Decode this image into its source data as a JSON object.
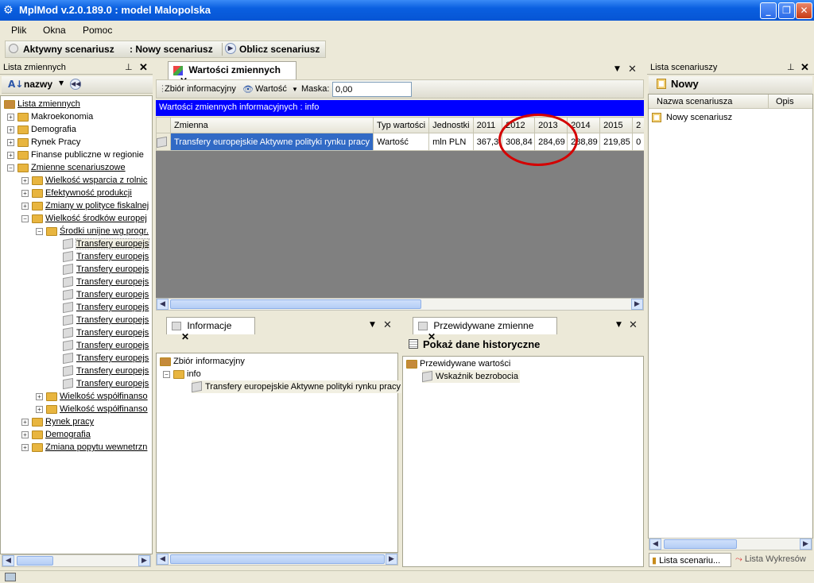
{
  "window": {
    "title": "MplMod v.2.0.189.0 : model Malopolska"
  },
  "menu": [
    "Plik",
    "Okna",
    "Pomoc"
  ],
  "scenario_bar": {
    "active_label": "Aktywny scenariusz",
    "active_value": ": Nowy scenariusz",
    "compute_label": "Oblicz scenariusz"
  },
  "left_panel": {
    "title": "Lista zmiennych",
    "sort_label": "nazwy",
    "tree": [
      {
        "label": "Lista zmiennych",
        "level": 0,
        "type": "root",
        "expander": ""
      },
      {
        "label": "Makroekonomia",
        "level": 1,
        "type": "folder",
        "expander": "+"
      },
      {
        "label": "Demografia",
        "level": 1,
        "type": "folder",
        "expander": "+"
      },
      {
        "label": "Rynek Pracy",
        "level": 1,
        "type": "folder",
        "expander": "+"
      },
      {
        "label": "Finanse publiczne w regionie",
        "level": 1,
        "type": "folder",
        "expander": "+"
      },
      {
        "label": "Zmienne scenariuszowe",
        "level": 1,
        "type": "folder",
        "expander": "-",
        "underline": true
      },
      {
        "label": "Wielkość wsparcia z rolnic",
        "level": 2,
        "type": "folder",
        "expander": "+",
        "underline": true
      },
      {
        "label": "Efektywność produkcji",
        "level": 2,
        "type": "folder",
        "expander": "+",
        "underline": true
      },
      {
        "label": "Zmiany w polityce fiskalnej",
        "level": 2,
        "type": "folder",
        "expander": "+",
        "underline": true
      },
      {
        "label": "Wielkość środków europej",
        "level": 2,
        "type": "folder",
        "expander": "-",
        "underline": true
      },
      {
        "label": "Środki unijne wg progr.",
        "level": 3,
        "type": "folder",
        "expander": "-",
        "underline": true
      },
      {
        "label": "Transfery europejs",
        "level": 4,
        "type": "cube",
        "expander": "",
        "underline": true,
        "selected": true
      },
      {
        "label": "Transfery europejs",
        "level": 4,
        "type": "cube",
        "expander": "",
        "underline": true
      },
      {
        "label": "Transfery europejs",
        "level": 4,
        "type": "cube",
        "expander": "",
        "underline": true
      },
      {
        "label": "Transfery europejs",
        "level": 4,
        "type": "cube",
        "expander": "",
        "underline": true
      },
      {
        "label": "Transfery europejs",
        "level": 4,
        "type": "cube",
        "expander": "",
        "underline": true
      },
      {
        "label": "Transfery europejs",
        "level": 4,
        "type": "cube",
        "expander": "",
        "underline": true
      },
      {
        "label": "Transfery europejs",
        "level": 4,
        "type": "cube",
        "expander": "",
        "underline": true
      },
      {
        "label": "Transfery europejs",
        "level": 4,
        "type": "cube",
        "expander": "",
        "underline": true
      },
      {
        "label": "Transfery europejs",
        "level": 4,
        "type": "cube",
        "expander": "",
        "underline": true
      },
      {
        "label": "Transfery europejs",
        "level": 4,
        "type": "cube",
        "expander": "",
        "underline": true
      },
      {
        "label": "Transfery europejs",
        "level": 4,
        "type": "cube",
        "expander": "",
        "underline": true
      },
      {
        "label": "Transfery europejs",
        "level": 4,
        "type": "cube",
        "expander": "",
        "underline": true
      },
      {
        "label": "Wielkość współfinanso",
        "level": 3,
        "type": "folder",
        "expander": "+",
        "underline": true
      },
      {
        "label": "Wielkość współfinanso",
        "level": 3,
        "type": "folder",
        "expander": "+",
        "underline": true
      },
      {
        "label": "Rynek pracy",
        "level": 2,
        "type": "folder",
        "expander": "+",
        "underline": true
      },
      {
        "label": "Demografia",
        "level": 2,
        "type": "folder",
        "expander": "+",
        "underline": true
      },
      {
        "label": "Zmiana popytu wewnetrzn",
        "level": 2,
        "type": "folder",
        "expander": "+",
        "underline": true
      }
    ]
  },
  "values_panel": {
    "tab": "Wartości zmiennych",
    "toolbar": {
      "set_label": "Zbiór informacyjny",
      "value_label": "Wartość",
      "mask_label": "Maska:",
      "mask_value": "0,00"
    },
    "header_bar": "Wartości zmiennych informacyjnych : info",
    "columns": [
      "Zmienna",
      "Typ wartości",
      "Jednostki",
      "2011",
      "2012",
      "2013",
      "2014",
      "2015",
      "2"
    ],
    "rows": [
      {
        "cells": [
          "Transfery europejskie Aktywne polityki rynku pracy",
          "Wartość",
          "mln PLN",
          "367,3",
          "308,84",
          "284,69",
          "288,89",
          "219,85",
          "0"
        ]
      }
    ]
  },
  "info_panel": {
    "tab": "Informacje",
    "tree": [
      "Zbiór informacyjny",
      "info",
      "Transfery europejskie Aktywne polityki rynku pracy"
    ]
  },
  "predicted_panel": {
    "tab": "Przewidywane zmienne",
    "history_label": "Pokaż dane historyczne",
    "tree": [
      "Przewidywane wartości",
      "Wskaźnik bezrobocia"
    ]
  },
  "right_panel": {
    "title": "Lista scenariuszy",
    "new_label": "Nowy",
    "columns": [
      "Nazwa scenariusza",
      "Opis"
    ],
    "items": [
      "Nowy scenariusz"
    ],
    "bottom_tabs": [
      "Lista scenariu...",
      "Lista Wykresów"
    ]
  },
  "colors": {
    "titlebar": "#0a5fe0",
    "header_bar": "#0000ff",
    "selection": "#316ac5",
    "grid_bg": "#808080",
    "annotation": "#d40000"
  }
}
